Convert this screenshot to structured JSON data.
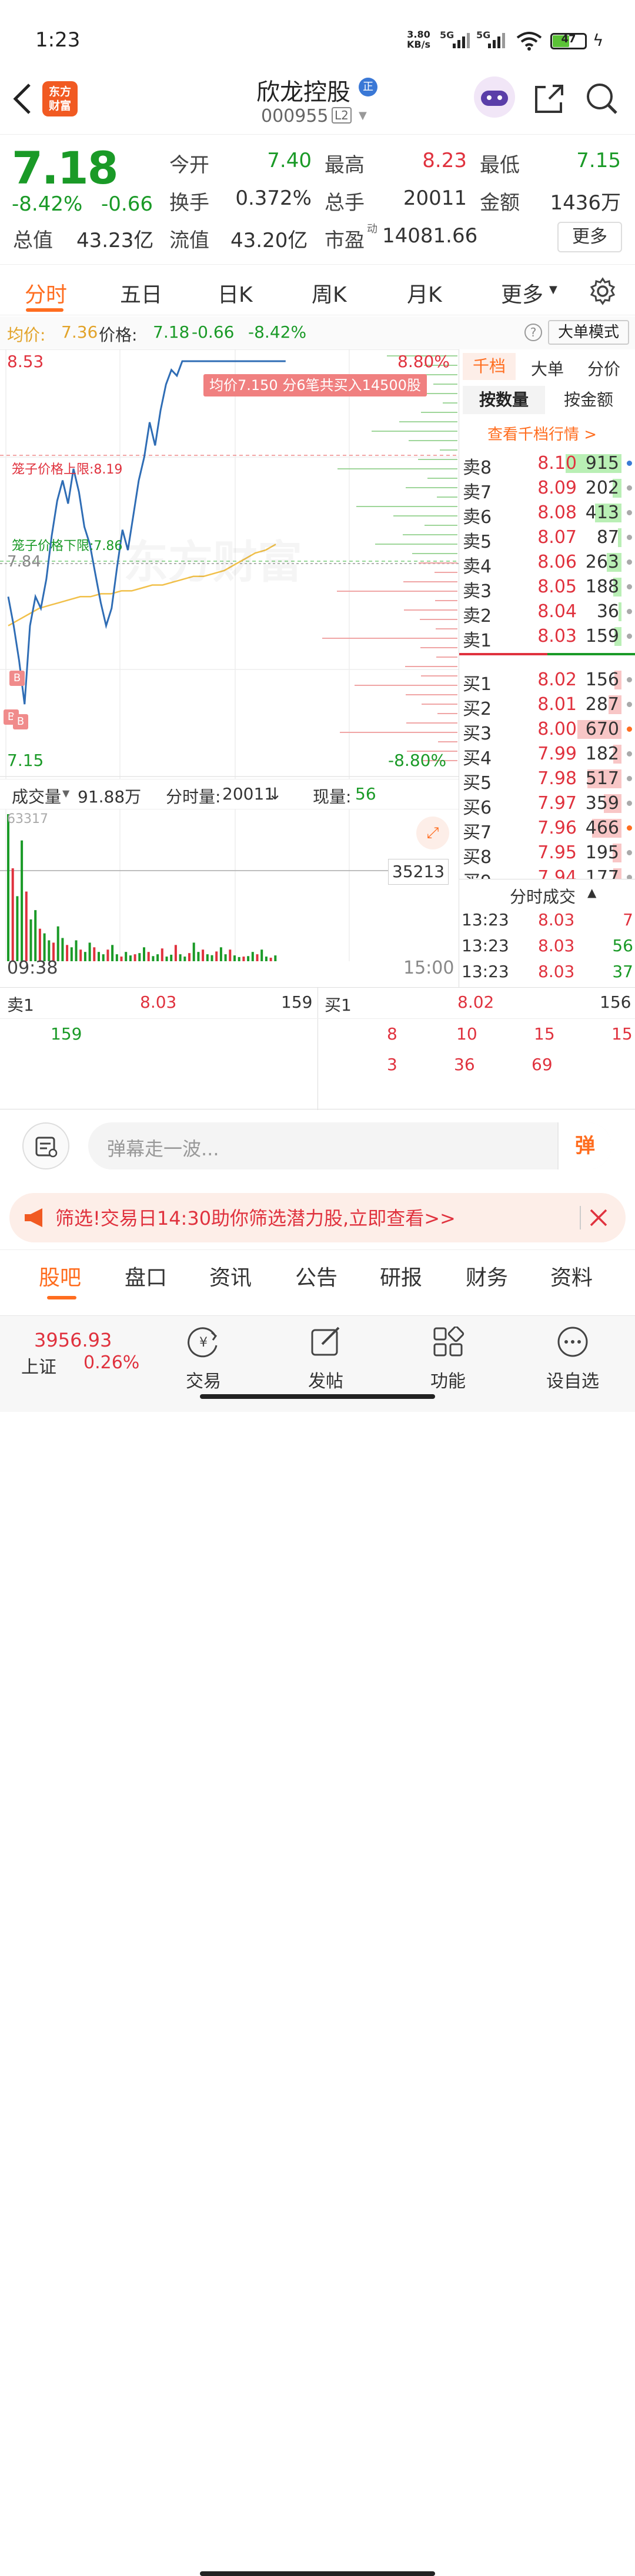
{
  "status": {
    "time": "1:23",
    "net_speed_top": "3.80",
    "net_speed_bottom": "KB/s",
    "sig1": "5G",
    "sig2": "5G",
    "battery": "47"
  },
  "header": {
    "logo_top": "东方",
    "logo_bottom": "财富",
    "stock_name": "欣龙控股",
    "badge": "正",
    "stock_code": "000955",
    "level": "L2"
  },
  "quote": {
    "price": "7.18",
    "change_pct": "-8.42%",
    "change": "-0.66",
    "open_label": "今开",
    "open": "7.40",
    "high_label": "最高",
    "high": "8.23",
    "low_label": "最低",
    "low": "7.15",
    "turnover_label": "换手",
    "turnover": "0.372%",
    "vol_label": "总手",
    "vol": "20011",
    "amount_label": "金额",
    "amount": "1436万",
    "mcap_label": "总值",
    "mcap": "43.23亿",
    "float_label": "流值",
    "float": "43.20亿",
    "pe_label": "市盈",
    "pe_sup": "动",
    "pe": "14081.66",
    "more_button": "更多"
  },
  "tabs": [
    "分时",
    "五日",
    "日K",
    "周K",
    "月K",
    "更多"
  ],
  "infobar": {
    "avg_label": "均价:",
    "avg": "7.36",
    "price_label": "价格:",
    "price": "7.18",
    "change": "-0.66",
    "change_pct": "-8.42%",
    "help": "?",
    "mode_button": "大单模式"
  },
  "chart": {
    "y_top": "8.53",
    "y_top_pct": "8.80%",
    "y_mid": "7.84",
    "y_bottom": "7.15",
    "y_bottom_pct": "-8.80%",
    "tooltip": "均价7.150  分6笔共买入14500股",
    "upper_limit": "笼子价格上限:8.19",
    "lower_limit": "笼子价格下限:7.86",
    "watermark": "东方财富",
    "vol_label": "成交量",
    "vol_value": "91.88万",
    "fs_label": "分时量:",
    "fs_value": "20011",
    "fs_arrow": "↓",
    "now_label": "现量:",
    "now_value": "56",
    "vol_max": "63317",
    "vol_ref": "35213",
    "time_start": "09:38",
    "time_end": "15:00",
    "marker": "B"
  },
  "chart_data": {
    "type": "line",
    "series": [
      {
        "values": [
          7.72,
          7.62,
          7.5,
          7.35,
          7.62,
          7.72,
          7.68,
          7.78,
          7.93,
          8.05,
          8.12,
          8.04,
          8.16,
          8.08,
          7.96,
          7.9,
          7.8,
          7.7,
          7.62,
          7.68,
          7.82,
          7.95,
          7.88,
          8.0,
          8.12,
          8.2,
          8.32,
          8.24,
          8.36,
          8.45,
          8.5,
          8.48,
          8.56,
          8.7,
          8.65,
          8.6,
          8.7,
          8.72,
          8.62,
          8.68,
          8.92,
          8.85,
          8.78,
          8.8,
          8.74,
          8.94,
          9.03,
          9.19,
          9.1,
          9.03,
          8.95,
          8.98
        ]
      },
      {
        "values": [
          7.62,
          7.64,
          7.66,
          7.68,
          7.69,
          7.7,
          7.71,
          7.72,
          7.72,
          7.73,
          7.73,
          7.74,
          7.74,
          7.75,
          7.76,
          7.76,
          7.77,
          7.78,
          7.79,
          7.79,
          7.8,
          7.81,
          7.83,
          7.85,
          7.87,
          7.88,
          7.9
        ]
      }
    ],
    "ylim": [
      7.15,
      8.53
    ],
    "volumes": [
      63317,
      40000,
      28000,
      52000,
      30000,
      18000,
      22000,
      14000,
      12000,
      9000,
      8000,
      15000,
      10000,
      7000,
      6000,
      9000,
      5000,
      4000,
      8000,
      6000,
      4000,
      3000,
      5000,
      7000,
      3000,
      2000,
      4000,
      2500,
      3000,
      3500,
      6000,
      4000,
      2200,
      3000,
      5500,
      2000,
      2800,
      7000,
      3000,
      2000,
      3500,
      8000,
      4000,
      5000,
      3000,
      2600,
      4200,
      6000,
      3000,
      5000,
      2500,
      1800,
      2000,
      2200,
      4000,
      3000,
      5000,
      2000,
      1500,
      2500
    ]
  },
  "orderbook": {
    "tab_qiandang": "千档",
    "tab_dadan": "大单",
    "tab_fenjia": "分价",
    "btn_by_qty": "按数量",
    "btn_by_amt": "按金额",
    "view_link": "查看千档行情 >",
    "sells": [
      {
        "label": "卖8",
        "price": "8.10",
        "vol": "915",
        "bar": 0.95,
        "dot": "#3a7bd5"
      },
      {
        "label": "卖7",
        "price": "8.09",
        "vol": "202",
        "bar": 0.15,
        "dot": "#aaa"
      },
      {
        "label": "卖6",
        "price": "8.08",
        "vol": "413",
        "bar": 0.45,
        "dot": "#aaa"
      },
      {
        "label": "卖5",
        "price": "8.07",
        "vol": "87",
        "bar": 0.06,
        "dot": "#aaa"
      },
      {
        "label": "卖4",
        "price": "8.06",
        "vol": "263",
        "bar": 0.25,
        "dot": "#aaa"
      },
      {
        "label": "卖3",
        "price": "8.05",
        "vol": "188",
        "bar": 0.14,
        "dot": "#aaa"
      },
      {
        "label": "卖2",
        "price": "8.04",
        "vol": "36",
        "bar": 0.05,
        "dot": "#aaa"
      },
      {
        "label": "卖1",
        "price": "8.03",
        "vol": "159",
        "bar": 0.12,
        "dot": "#aaa"
      }
    ],
    "buys": [
      {
        "label": "买1",
        "price": "8.02",
        "vol": "156",
        "bar": 0.12,
        "dot": "#aaa"
      },
      {
        "label": "买2",
        "price": "8.01",
        "vol": "287",
        "bar": 0.22,
        "dot": "#aaa"
      },
      {
        "label": "买3",
        "price": "8.00",
        "vol": "670",
        "bar": 0.75,
        "dot": "#ff6d1f"
      },
      {
        "label": "买4",
        "price": "7.99",
        "vol": "182",
        "bar": 0.14,
        "dot": "#aaa"
      },
      {
        "label": "买5",
        "price": "7.98",
        "vol": "517",
        "bar": 0.58,
        "dot": "#aaa"
      },
      {
        "label": "买6",
        "price": "7.97",
        "vol": "359",
        "bar": 0.3,
        "dot": "#aaa"
      },
      {
        "label": "买7",
        "price": "7.96",
        "vol": "466",
        "bar": 0.5,
        "dot": "#ff6d1f"
      },
      {
        "label": "买8",
        "price": "7.95",
        "vol": "195",
        "bar": 0.15,
        "dot": "#aaa"
      },
      {
        "label": "买9",
        "price": "7.94",
        "vol": "177",
        "bar": 0.14,
        "dot": "#aaa"
      }
    ],
    "ticks_title": "分时成交",
    "ticks": [
      {
        "time": "13:23",
        "price": "8.03",
        "vol": "7"
      },
      {
        "time": "13:23",
        "price": "8.03",
        "vol": "56"
      },
      {
        "time": "13:23",
        "price": "8.03",
        "vol": "37"
      }
    ]
  },
  "depth": {
    "sell_label": "卖1",
    "sell_price": "8.03",
    "sell_vol": "159",
    "buy_label": "买1",
    "buy_price": "8.02",
    "buy_vol": "156",
    "sell_orders": [
      "159"
    ],
    "buy_row1": [
      "8",
      "10",
      "15",
      "15"
    ],
    "buy_row2": [
      "3",
      "36",
      "69"
    ]
  },
  "danmu": {
    "placeholder": "弹幕走一波...",
    "button": "弹"
  },
  "banner": {
    "text": "筛选!交易日14:30助你筛选潜力股,立即查看>>"
  },
  "subtabs": [
    "股吧",
    "盘口",
    "资讯",
    "公告",
    "研报",
    "财务",
    "资料"
  ],
  "bottomnav": {
    "index_value": "3956.93",
    "index_name": "上证",
    "index_pct": "0.26%",
    "items": [
      "交易",
      "发帖",
      "功能",
      "设自选"
    ]
  }
}
